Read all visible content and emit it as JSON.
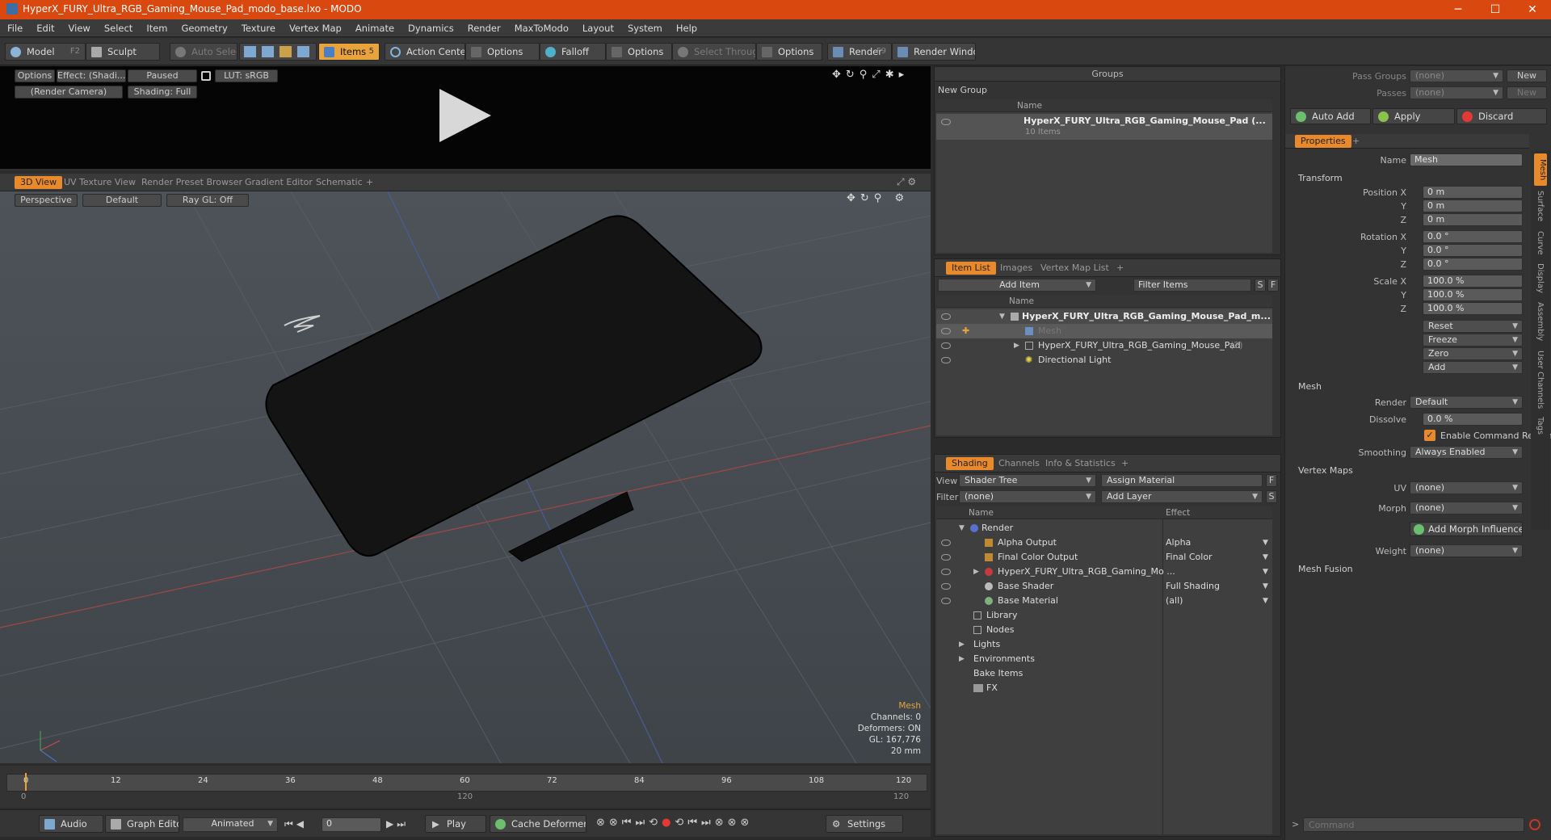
{
  "window": {
    "title": "HyperX_FURY_Ultra_RGB_Gaming_Mouse_Pad_modo_base.lxo - MODO",
    "minimize": "─",
    "maximize": "☐",
    "close": "✕"
  },
  "menu": [
    "File",
    "Edit",
    "View",
    "Select",
    "Item",
    "Geometry",
    "Texture",
    "Vertex Map",
    "Animate",
    "Dynamics",
    "Render",
    "MaxToModo",
    "Layout",
    "System",
    "Help"
  ],
  "toolbar": {
    "model": "Model",
    "model_key": "F2",
    "sculpt": "Sculpt",
    "auto_select": "Auto Select",
    "items": "Items",
    "items_key": "5",
    "action_center": "Action Center",
    "options1": "Options",
    "falloff": "Falloff",
    "options2": "Options",
    "select_through": "Select Through",
    "options3": "Options",
    "render": "Render",
    "render_key": "F9",
    "render_window": "Render Window"
  },
  "preview": {
    "options": "Options",
    "effect": "Effect: (Shadi...",
    "paused": "Paused",
    "lut": "LUT: sRGB",
    "camera": "(Render Camera)",
    "shading": "Shading: Full"
  },
  "viewport": {
    "tabs": [
      "3D View",
      "UV Texture View",
      "Render Preset Browser",
      "Gradient Editor",
      "Schematic",
      "+"
    ],
    "perspective": "Perspective",
    "default": "Default",
    "raygl": "Ray GL: Off",
    "info": {
      "mesh": "Mesh",
      "channels": "Channels: 0",
      "deformers": "Deformers: ON",
      "gl": "GL: 167,776",
      "size": "20 mm"
    }
  },
  "timeline": {
    "ticks": [
      "0",
      "12",
      "24",
      "36",
      "48",
      "60",
      "72",
      "84",
      "96",
      "108",
      "120"
    ],
    "sub_start": "0",
    "sub_mid": "120",
    "sub_end": "120"
  },
  "bottombar": {
    "audio": "Audio",
    "graph_editor": "Graph Editor",
    "animated": "Animated",
    "frame": "0",
    "play": "Play",
    "cache": "Cache Deformers",
    "settings": "Settings"
  },
  "groups": {
    "title": "Groups",
    "new_group": "New Group",
    "col_name": "Name",
    "item_name": "HyperX_FURY_Ultra_RGB_Gaming_Mouse_Pad (...",
    "item_count": "10 Items"
  },
  "itemlist": {
    "tabs": [
      "Item List",
      "Images",
      "Vertex Map List",
      "+"
    ],
    "add_item": "Add Item",
    "filter": "Filter Items",
    "s": "S",
    "f": "F",
    "col_name": "Name",
    "rows": [
      "HyperX_FURY_Ultra_RGB_Gaming_Mouse_Pad_m...",
      "Mesh",
      "HyperX_FURY_Ultra_RGB_Gaming_Mouse_Pad",
      "(2)",
      "Directional Light"
    ]
  },
  "shading": {
    "tabs": [
      "Shading",
      "Channels",
      "Info & Statistics",
      "+"
    ],
    "view_lbl": "View",
    "view_val": "Shader Tree",
    "assign": "Assign Material",
    "f": "F",
    "filter_lbl": "Filter",
    "filter_val": "(none)",
    "add_layer": "Add Layer",
    "s": "S",
    "col_name": "Name",
    "col_effect": "Effect",
    "rows": [
      {
        "name": "Render",
        "effect": ""
      },
      {
        "name": "Alpha Output",
        "effect": "Alpha"
      },
      {
        "name": "Final Color Output",
        "effect": "Final Color"
      },
      {
        "name": "HyperX_FURY_Ultra_RGB_Gaming_Mo ...",
        "effect": ""
      },
      {
        "name": "Base Shader",
        "effect": "Full Shading"
      },
      {
        "name": "Base Material",
        "effect": "(all)"
      },
      {
        "name": "Library",
        "effect": ""
      },
      {
        "name": "Nodes",
        "effect": ""
      },
      {
        "name": "Lights",
        "effect": ""
      },
      {
        "name": "Environments",
        "effect": ""
      },
      {
        "name": "Bake Items",
        "effect": ""
      },
      {
        "name": "FX",
        "effect": ""
      }
    ]
  },
  "props": {
    "pass_groups": "Pass Groups",
    "pass_groups_val": "(none)",
    "passes": "Passes",
    "passes_val": "(none)",
    "new": "New",
    "new2": "New",
    "auto_add": "Auto Add",
    "apply": "Apply",
    "discard": "Discard",
    "tab": "Properties",
    "plus": "+",
    "name_lbl": "Name",
    "name_val": "Mesh",
    "transform": "Transform",
    "pos_lbl": "Position X",
    "y": "Y",
    "z": "Z",
    "pos": [
      "0 m",
      "0 m",
      "0 m"
    ],
    "rot_lbl": "Rotation X",
    "rot": [
      "0.0 °",
      "0.0 °",
      "0.0 °"
    ],
    "scale_lbl": "Scale X",
    "scale": [
      "100.0 %",
      "100.0 %",
      "100.0 %"
    ],
    "reset": "Reset",
    "freeze": "Freeze",
    "zero": "Zero",
    "add": "Add",
    "mesh": "Mesh",
    "render_lbl": "Render",
    "render_val": "Default",
    "dissolve_lbl": "Dissolve",
    "dissolve_val": "0.0 %",
    "enable_cmd": "Enable Command Regions",
    "smoothing_lbl": "Smoothing",
    "smoothing_val": "Always Enabled",
    "vertex_maps": "Vertex Maps",
    "uv_lbl": "UV",
    "uv_val": "(none)",
    "morph_lbl": "Morph",
    "morph_val": "(none)",
    "add_morph": "Add Morph Influence",
    "weight_lbl": "Weight",
    "weight_val": "(none)",
    "mesh_fusion": "Mesh Fusion",
    "side_tabs": [
      "Mesh",
      "Surface",
      "Curve",
      "Display",
      "Assembly",
      "User Channels",
      "Tags"
    ]
  },
  "command": {
    "placeholder": "Command"
  }
}
